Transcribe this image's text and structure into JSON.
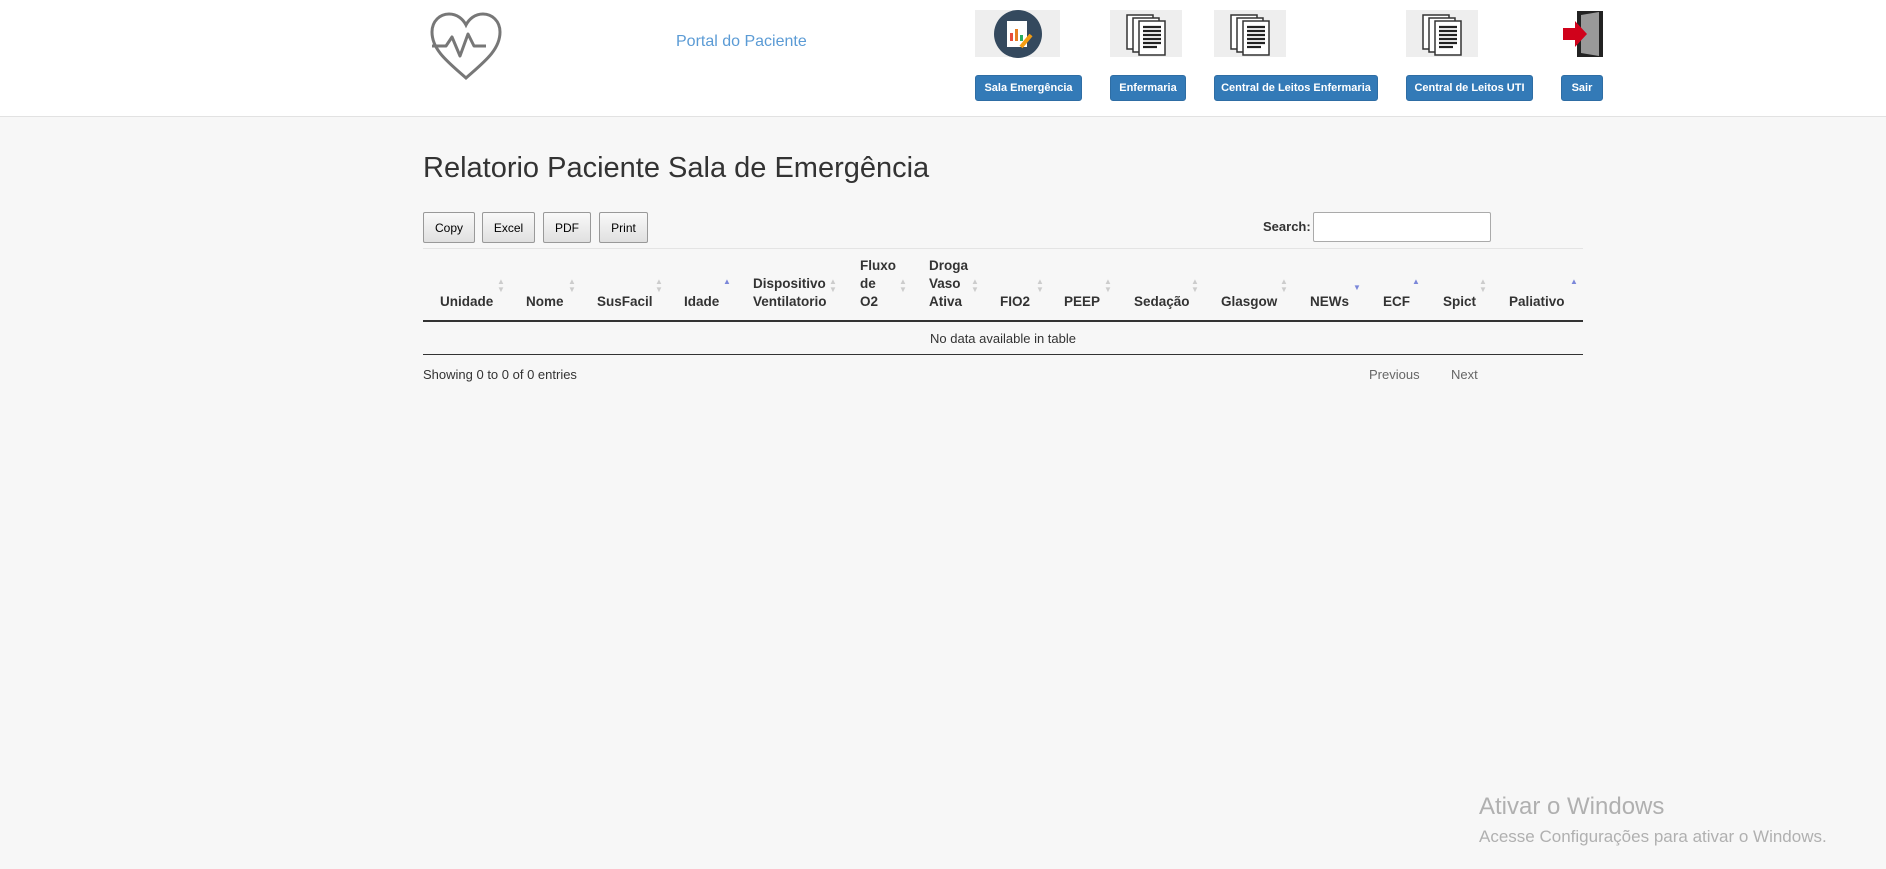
{
  "header": {
    "portal_title": "Portal do Paciente",
    "nav": [
      {
        "label": "Sala Emergência",
        "icon": "chart-report-icon"
      },
      {
        "label": "Enfermaria",
        "icon": "documents-icon"
      },
      {
        "label": "Central de Leitos Enfermaria",
        "icon": "documents-icon"
      },
      {
        "label": "Central de Leitos UTI",
        "icon": "documents-icon"
      },
      {
        "label": "Sair",
        "icon": "exit-door-icon"
      }
    ]
  },
  "page": {
    "title": "Relatorio Paciente Sala de Emergência"
  },
  "toolbar": {
    "copy": "Copy",
    "excel": "Excel",
    "pdf": "PDF",
    "print": "Print",
    "search_label": "Search:",
    "search_value": ""
  },
  "table": {
    "columns": [
      "Unidade",
      "Nome",
      "SusFacil",
      "Idade",
      "Dispositivo Ventilatorio",
      "Fluxo de O2",
      "Droga Vaso Ativa",
      "FIO2",
      "PEEP",
      "Sedação",
      "Glasgow",
      "NEWs",
      "ECF",
      "Spict",
      "Paliativo"
    ],
    "column_lines": {
      "dispositivo": [
        "Dispositivo",
        "Ventilatorio"
      ],
      "fluxo": [
        "Fluxo",
        "de",
        "O2"
      ],
      "droga": [
        "Droga",
        "Vaso",
        "Ativa"
      ]
    },
    "empty_message": "No data available in table"
  },
  "footer": {
    "info": "Showing 0 to 0 of 0 entries",
    "previous": "Previous",
    "next": "Next"
  },
  "watermark": {
    "line1": "Ativar o Windows",
    "line2": "Acesse Configurações para ativar o Windows."
  },
  "colors": {
    "primary_button": "#337ab7",
    "sort_active": "#7b87d9",
    "logo_stroke": "#777777"
  }
}
